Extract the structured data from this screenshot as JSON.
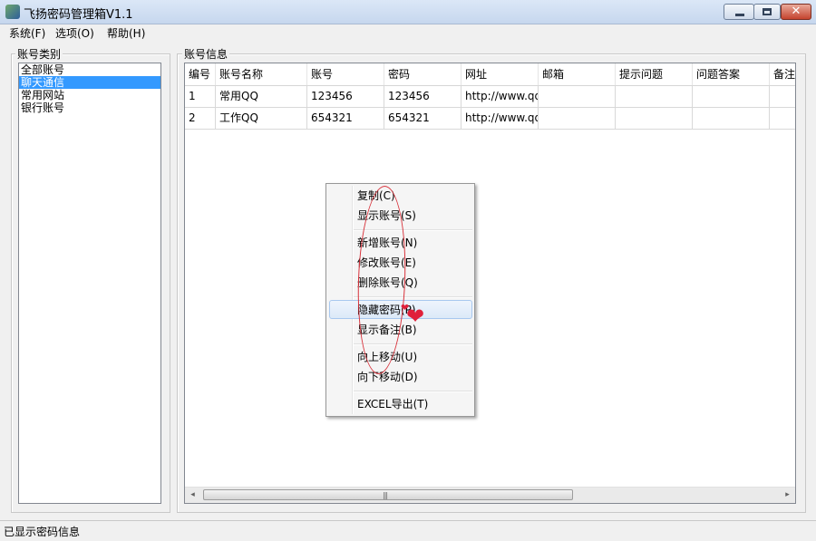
{
  "window": {
    "title": "飞扬密码管理箱V1.1",
    "controls": {
      "minimize": "",
      "maximize": "",
      "close": "✕"
    }
  },
  "menubar": [
    {
      "label": "系统(F)"
    },
    {
      "label": "选项(O)"
    },
    {
      "label": "帮助(H)"
    }
  ],
  "category_panel": {
    "title": "账号类别",
    "items": [
      {
        "label": "全部账号"
      },
      {
        "label": "聊天通信",
        "selected": true
      },
      {
        "label": "常用网站"
      },
      {
        "label": "银行账号"
      }
    ]
  },
  "account_panel": {
    "title": "账号信息",
    "columns": [
      "编号",
      "账号名称",
      "账号",
      "密码",
      "网址",
      "邮箱",
      "提示问题",
      "问题答案",
      "备注"
    ],
    "rows": [
      [
        "1",
        "常用QQ",
        "123456",
        "123456",
        "http://www.qq",
        "",
        "",
        "",
        ""
      ],
      [
        "2",
        "工作QQ",
        "654321",
        "654321",
        "http://www.qq",
        "",
        "",
        "",
        ""
      ]
    ],
    "scrollbar": {
      "left_arrow": "◂",
      "right_arrow": "▸",
      "grip": "|||"
    }
  },
  "context_menu": {
    "items": [
      {
        "label": "复制(C)"
      },
      {
        "label": "显示账号(S)"
      },
      {
        "label": "新增账号(N)"
      },
      {
        "label": "修改账号(E)"
      },
      {
        "label": "删除账号(Q)"
      },
      {
        "label": "隐藏密码(P)",
        "hovered": true
      },
      {
        "label": "显示备注(B)"
      },
      {
        "label": "向上移动(U)"
      },
      {
        "label": "向下移动(D)"
      },
      {
        "label": "EXCEL导出(T)"
      }
    ],
    "annotation_color": "#d8313a",
    "heart": "❤"
  },
  "status_bar": {
    "text": "已显示密码信息"
  }
}
